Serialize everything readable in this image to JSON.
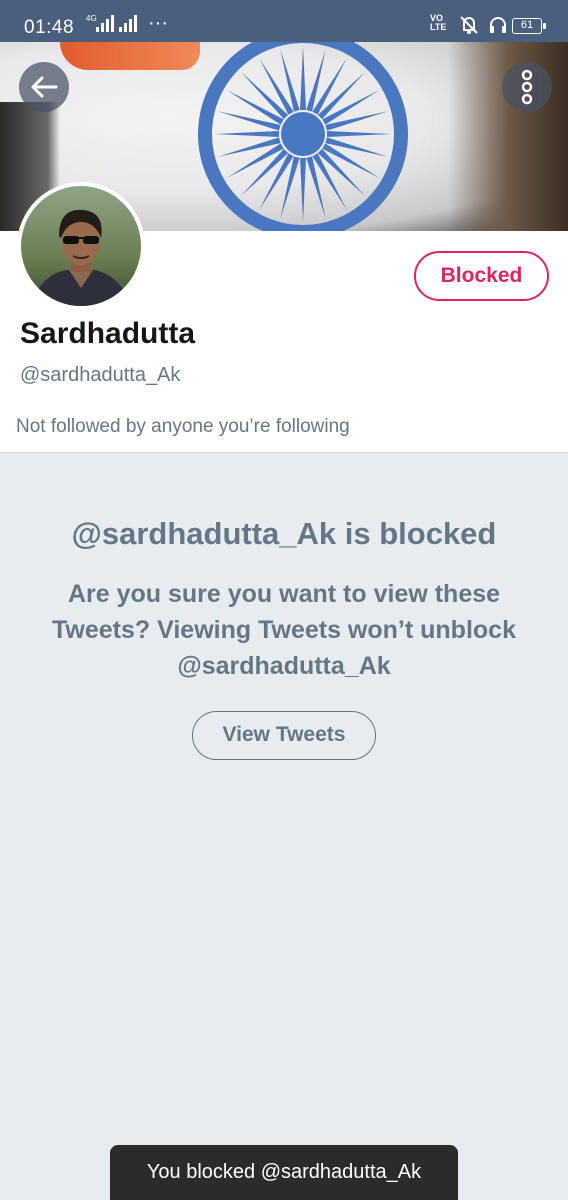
{
  "status_bar": {
    "time": "01:48",
    "network": "4G",
    "more": "···",
    "volte": [
      "VO",
      "LTE"
    ],
    "battery": "61"
  },
  "header": {
    "back_icon": "arrow-left-icon",
    "more_icon": "vertical-dots-icon"
  },
  "profile": {
    "name": "Sardhadutta",
    "handle": "@sardhadutta_Ak",
    "followed_note": "Not followed by anyone you’re following",
    "blocked_button": "Blocked"
  },
  "blocked_notice": {
    "title": "@sardhadutta_Ak is blocked",
    "description": "Are you sure you want to view these Tweets? Viewing Tweets won’t unblock @sardhadutta_Ak",
    "view_button": "View Tweets"
  },
  "toast": {
    "message": "You blocked @sardhadutta_Ak"
  },
  "colors": {
    "accent_blocked": "#e0245e",
    "secondary_text": "#657786",
    "background": "#e6ecf0",
    "status_bar": "#4a5f7e"
  }
}
